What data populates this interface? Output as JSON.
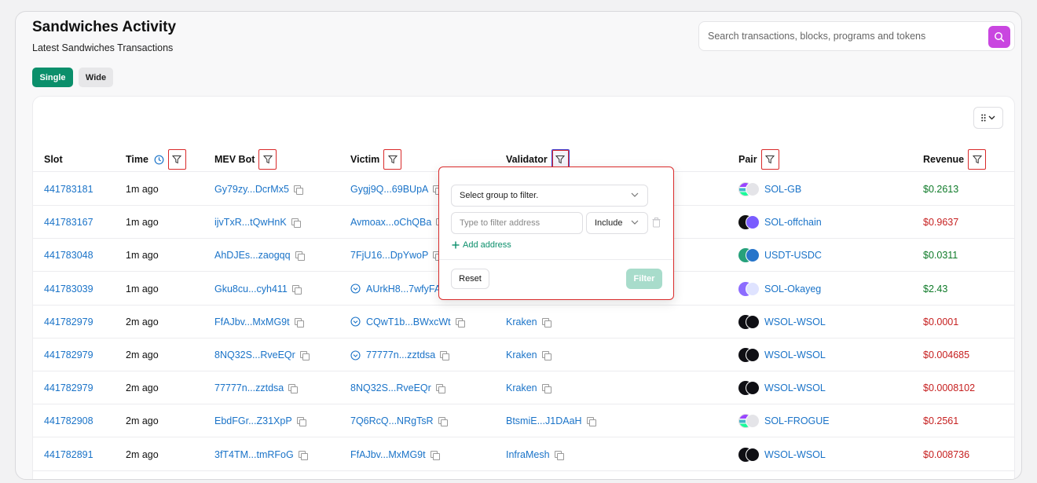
{
  "header": {
    "title": "Sandwiches Activity",
    "subtitle": "Latest Sandwiches Transactions"
  },
  "search": {
    "placeholder": "Search transactions, blocks, programs and tokens"
  },
  "view_toggle": {
    "single_label": "Single",
    "wide_label": "Wide",
    "selected": "Single"
  },
  "table": {
    "columns": [
      "Slot",
      "Time",
      "MEV Bot",
      "Victim",
      "Validator",
      "Pair",
      "Revenue"
    ],
    "rows": [
      {
        "slot": "441783181",
        "time": "1m ago",
        "mev_bot": "Gy79zy...DcrMx5",
        "victim": "Gygj9Q...69BUpA",
        "victim_icon": false,
        "validator": "",
        "pair": "SOL-GB",
        "pair_icon": "sol-stack",
        "revenue": "$0.2613",
        "revenue_color": "green"
      },
      {
        "slot": "441783167",
        "time": "1m ago",
        "mev_bot": "ijvTxR...tQwHnK",
        "victim": "Avmoax...oChQBa",
        "victim_icon": false,
        "validator": "",
        "pair": "SOL-offchain",
        "pair_icon": "sol-dark",
        "revenue": "$0.9637",
        "revenue_color": "red"
      },
      {
        "slot": "441783048",
        "time": "1m ago",
        "mev_bot": "AhDJEs...zaogqq",
        "victim": "7FjU16...DpYwoP",
        "victim_icon": false,
        "validator": "",
        "pair": "USDT-USDC",
        "pair_icon": "usdt-usdc",
        "revenue": "$0.0311",
        "revenue_color": "green"
      },
      {
        "slot": "441783039",
        "time": "1m ago",
        "mev_bot": "Gku8cu...cyh411",
        "victim": "AUrkH8...7wfyFA",
        "victim_icon": true,
        "validator": "",
        "pair": "SOL-Okayeg",
        "pair_icon": "sol-purple",
        "revenue": "$2.43",
        "revenue_color": "green"
      },
      {
        "slot": "441782979",
        "time": "2m ago",
        "mev_bot": "FfAJbv...MxMG9t",
        "victim": "CQwT1b...BWxcWt",
        "victim_icon": true,
        "validator": "Kraken",
        "pair": "WSOL-WSOL",
        "pair_icon": "wsol",
        "revenue": "$0.0001",
        "revenue_color": "red"
      },
      {
        "slot": "441782979",
        "time": "2m ago",
        "mev_bot": "8NQ32S...RveEQr",
        "victim": "77777n...zztdsa",
        "victim_icon": true,
        "validator": "Kraken",
        "pair": "WSOL-WSOL",
        "pair_icon": "wsol",
        "revenue": "$0.004685",
        "revenue_color": "red"
      },
      {
        "slot": "441782979",
        "time": "2m ago",
        "mev_bot": "77777n...zztdsa",
        "victim": "8NQ32S...RveEQr",
        "victim_icon": false,
        "validator": "Kraken",
        "pair": "WSOL-WSOL",
        "pair_icon": "wsol",
        "revenue": "$0.0008102",
        "revenue_color": "red"
      },
      {
        "slot": "441782908",
        "time": "2m ago",
        "mev_bot": "EbdFGr...Z31XpP",
        "victim": "7Q6RcQ...NRgTsR",
        "victim_icon": false,
        "validator": "BtsmiE...J1DAaH",
        "pair": "SOL-FROGUE",
        "pair_icon": "sol-stack",
        "revenue": "$0.2561",
        "revenue_color": "red"
      },
      {
        "slot": "441782891",
        "time": "2m ago",
        "mev_bot": "3fT4TM...tmRFoG",
        "victim": "FfAJbv...MxMG9t",
        "victim_icon": false,
        "validator": "InfraMesh",
        "pair": "WSOL-WSOL",
        "pair_icon": "wsol",
        "revenue": "$0.008736",
        "revenue_color": "red"
      }
    ]
  },
  "filter_popup": {
    "group_placeholder": "Select group to filter.",
    "address_placeholder": "Type to filter address",
    "mode_value": "Include",
    "add_address_label": "Add address",
    "reset_label": "Reset",
    "filter_label": "Filter"
  },
  "colors": {
    "accent_green": "#0b8f6b",
    "search_button": "#c946e0",
    "link_blue": "#1a73c8",
    "revenue_green": "#0e7a28",
    "revenue_red": "#c62020",
    "highlight_red": "#d92a2a"
  }
}
